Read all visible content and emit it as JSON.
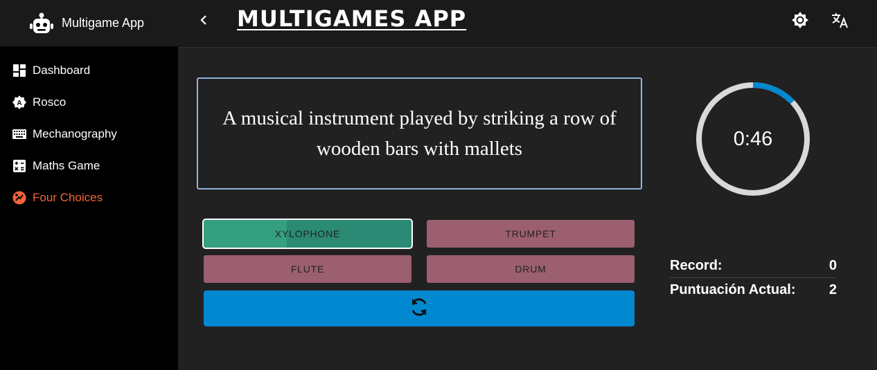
{
  "app": {
    "brand": "Multigame App",
    "title": "MULTIGAMES APP"
  },
  "sidebar": {
    "items": [
      {
        "label": "Dashboard",
        "icon": "dashboard-icon"
      },
      {
        "label": "Rosco",
        "icon": "rosco-icon"
      },
      {
        "label": "Mechanography",
        "icon": "keyboard-icon"
      },
      {
        "label": "Maths Game",
        "icon": "calculator-icon"
      },
      {
        "label": "Four Choices",
        "icon": "quiz-icon",
        "active": true
      }
    ]
  },
  "topbar": {
    "theme_icon": "brightness-icon",
    "language_icon": "translate-icon",
    "back_icon": "chevron-left-icon"
  },
  "game": {
    "question": "A musical instrument played by striking a row of wooden bars with mallets",
    "choices": [
      {
        "label": "XYLOPHONE",
        "state": "correct"
      },
      {
        "label": "TRUMPET",
        "state": "default"
      },
      {
        "label": "FLUTE",
        "state": "default"
      },
      {
        "label": "DRUM",
        "state": "default"
      }
    ],
    "refresh_icon": "refresh-icon"
  },
  "timer": {
    "display": "0:46",
    "remaining_fraction": 0.13
  },
  "stats": {
    "record_label": "Record:",
    "record_value": "0",
    "score_label": "Puntuación Actual:",
    "score_value": "2"
  },
  "colors": {
    "accent_active": "#f2643a",
    "choice_default": "#9b5f70",
    "choice_correct": "#2b8a74",
    "refresh_button": "#0288d1",
    "timer_progress": "#0288d1",
    "timer_track": "#d9d9d9",
    "question_border": "#90b4de"
  }
}
